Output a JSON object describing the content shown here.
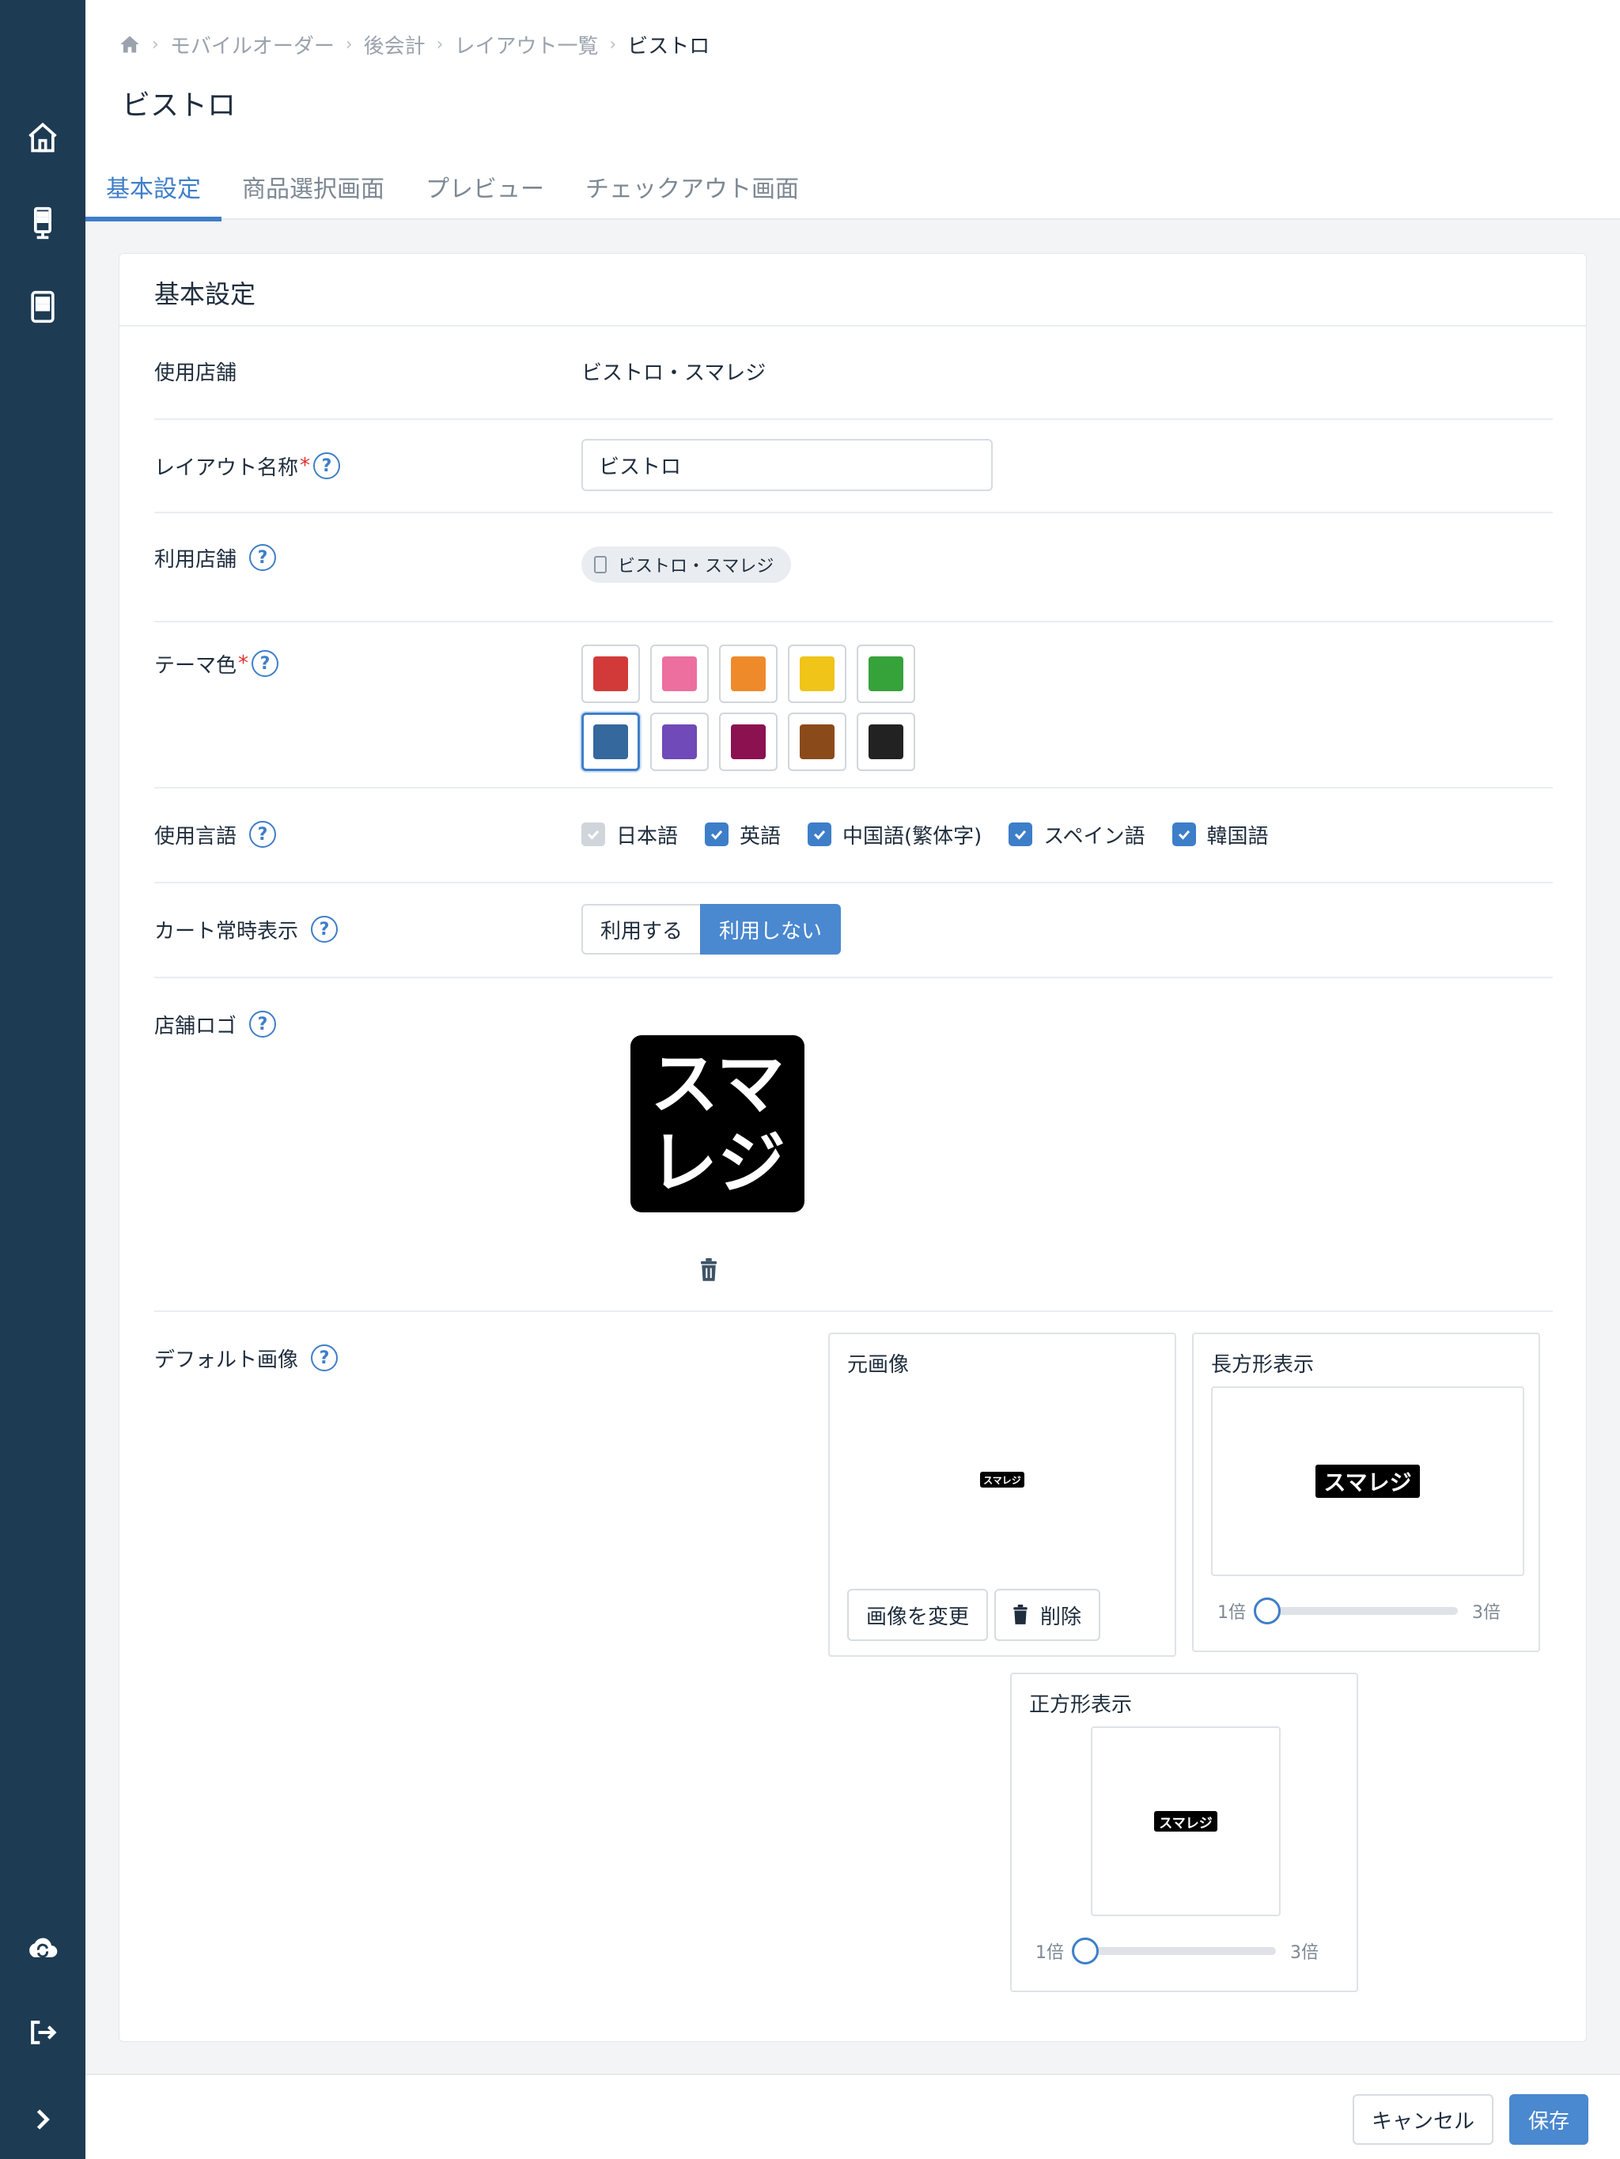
{
  "breadcrumb": {
    "items": [
      "モバイルオーダー",
      "後会計",
      "レイアウト一覧"
    ],
    "current": "ビストロ"
  },
  "page_title": "ビストロ",
  "tabs": [
    {
      "label": "基本設定",
      "active": true
    },
    {
      "label": "商品選択画面",
      "active": false
    },
    {
      "label": "プレビュー",
      "active": false
    },
    {
      "label": "チェックアウト画面",
      "active": false
    }
  ],
  "card": {
    "title": "基本設定",
    "store": {
      "label": "使用店舗",
      "value": "ビストロ・スマレジ"
    },
    "layout_name": {
      "label": "レイアウト名称",
      "required_mark": "*",
      "value": "ビストロ"
    },
    "available_stores": {
      "label": "利用店舗",
      "chip": "ビストロ・スマレジ"
    },
    "theme_color": {
      "label": "テーマ色",
      "required_mark": "*",
      "colors": [
        "#d23a3a",
        "#ec6fa0",
        "#ef8a2a",
        "#f0c419",
        "#36a23a",
        "#35689c",
        "#6f4ab8",
        "#8b1150",
        "#8b4a1a",
        "#222222"
      ],
      "selected_index": 5
    },
    "languages": {
      "label": "使用言語",
      "items": [
        {
          "label": "日本語",
          "checked": true,
          "disabled": true
        },
        {
          "label": "英語",
          "checked": true,
          "disabled": false
        },
        {
          "label": "中国語(繁体字)",
          "checked": true,
          "disabled": false
        },
        {
          "label": "スペイン語",
          "checked": true,
          "disabled": false
        },
        {
          "label": "韓国語",
          "checked": true,
          "disabled": false
        }
      ]
    },
    "cart_display": {
      "label": "カート常時表示",
      "option_on": "利用する",
      "option_off": "利用しない",
      "selected": "利用しない"
    },
    "store_logo": {
      "label": "店舗ロゴ",
      "logo_line1": "スマ",
      "logo_line2": "レジ"
    },
    "default_image": {
      "label": "デフォルト画像",
      "original": {
        "title": "元画像",
        "change_button": "画像を変更",
        "delete_button": "削除"
      },
      "rect": {
        "title": "長方形表示",
        "min": "1倍",
        "max": "3倍",
        "value": 1
      },
      "square": {
        "title": "正方形表示",
        "min": "1倍",
        "max": "3倍",
        "value": 1
      },
      "mini_logo_text": "スマレジ"
    }
  },
  "help_icon": "?",
  "footer": {
    "cancel": "キャンセル",
    "save": "保存"
  },
  "icons": [
    "home-icon",
    "kiosk-icon",
    "tablet-icon",
    "cloud-sync-icon",
    "logout-icon",
    "expand-icon"
  ]
}
